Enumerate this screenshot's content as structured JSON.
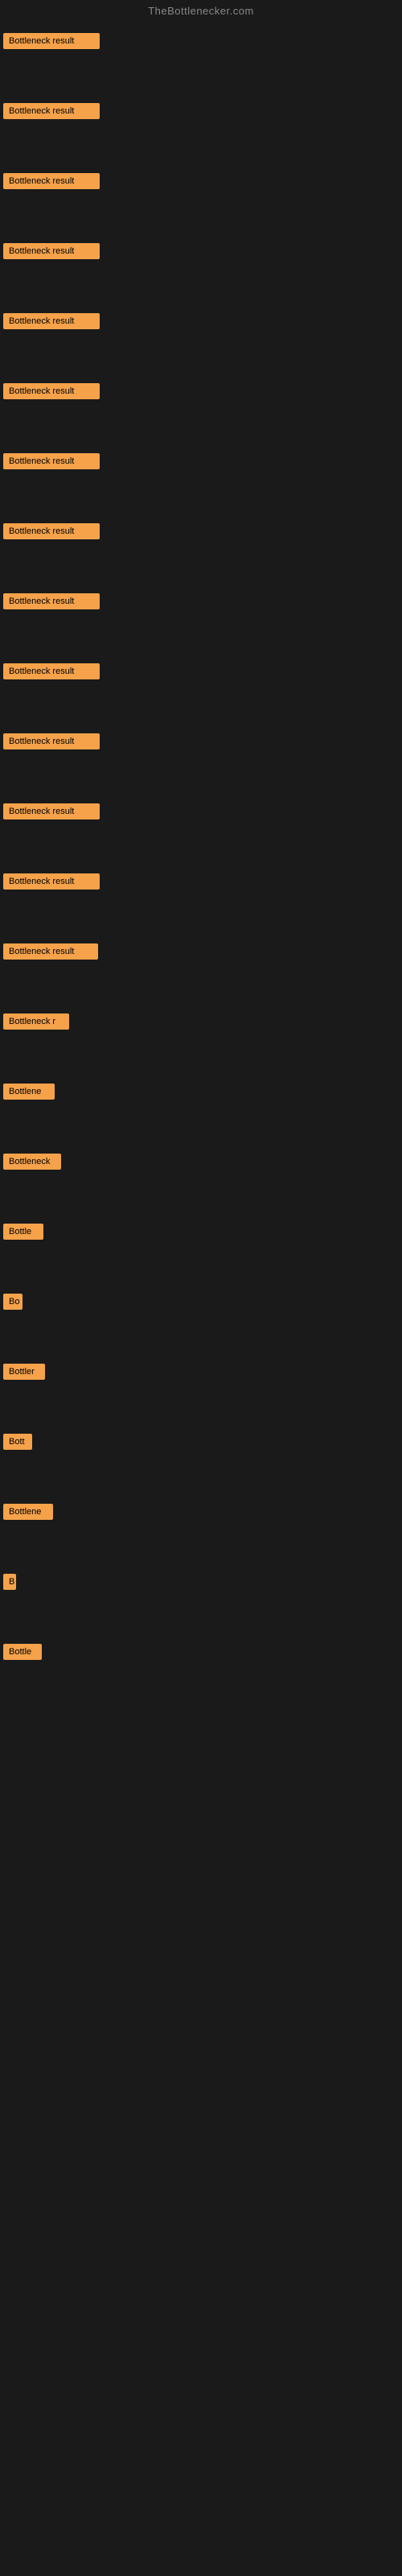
{
  "site": {
    "title": "TheBottlenecker.com"
  },
  "badge": {
    "label": "Bottleneck result",
    "color": "#f5a24a"
  },
  "rows": [
    {
      "id": 1,
      "label": "Bottleneck result",
      "width": 120
    },
    {
      "id": 2,
      "label": "Bottleneck result",
      "width": 120
    },
    {
      "id": 3,
      "label": "Bottleneck result",
      "width": 120
    },
    {
      "id": 4,
      "label": "Bottleneck result",
      "width": 120
    },
    {
      "id": 5,
      "label": "Bottleneck result",
      "width": 120
    },
    {
      "id": 6,
      "label": "Bottleneck result",
      "width": 120
    },
    {
      "id": 7,
      "label": "Bottleneck result",
      "width": 120
    },
    {
      "id": 8,
      "label": "Bottleneck result",
      "width": 120
    },
    {
      "id": 9,
      "label": "Bottleneck result",
      "width": 120
    },
    {
      "id": 10,
      "label": "Bottleneck result",
      "width": 120
    },
    {
      "id": 11,
      "label": "Bottleneck result",
      "width": 120
    },
    {
      "id": 12,
      "label": "Bottleneck result",
      "width": 120
    },
    {
      "id": 13,
      "label": "Bottleneck result",
      "width": 120
    },
    {
      "id": 14,
      "label": "Bottleneck result",
      "width": 118
    },
    {
      "id": 15,
      "label": "Bottleneck r",
      "width": 82
    },
    {
      "id": 16,
      "label": "Bottlene",
      "width": 64
    },
    {
      "id": 17,
      "label": "Bottleneck",
      "width": 72
    },
    {
      "id": 18,
      "label": "Bottle",
      "width": 50
    },
    {
      "id": 19,
      "label": "Bo",
      "width": 24
    },
    {
      "id": 20,
      "label": "Bottler",
      "width": 52
    },
    {
      "id": 21,
      "label": "Bott",
      "width": 36
    },
    {
      "id": 22,
      "label": "Bottlene",
      "width": 62
    },
    {
      "id": 23,
      "label": "B",
      "width": 16
    },
    {
      "id": 24,
      "label": "Bottle",
      "width": 48
    }
  ]
}
